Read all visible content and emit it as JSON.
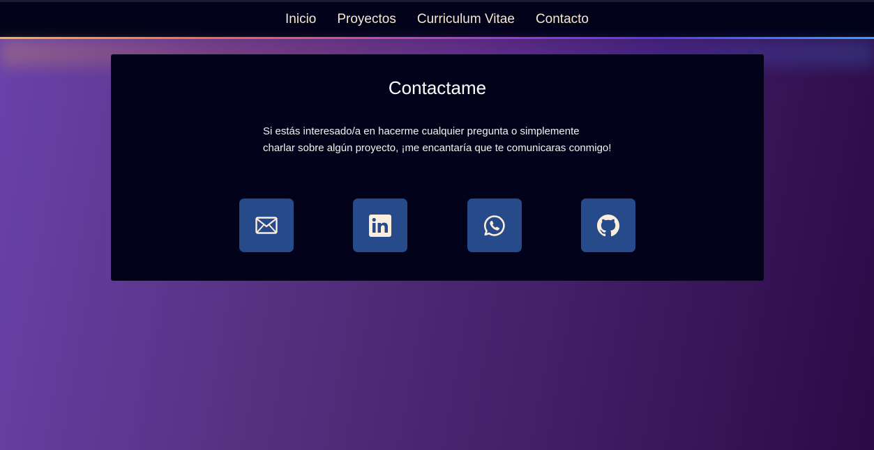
{
  "nav": {
    "items": [
      {
        "label": "Inicio"
      },
      {
        "label": "Proyectos"
      },
      {
        "label": "Curriculum Vitae"
      },
      {
        "label": "Contacto"
      }
    ]
  },
  "contact": {
    "title": "Contactame",
    "text": "Si estás interesado/a en hacerme cualquier pregunta o simplemente charlar sobre algún proyecto, ¡me encantaría que te comunicaras conmigo!",
    "links": [
      {
        "icon": "envelope-icon"
      },
      {
        "icon": "linkedin-icon"
      },
      {
        "icon": "whatsapp-icon"
      },
      {
        "icon": "github-icon"
      }
    ]
  },
  "colors": {
    "nav_text": "#f7e8cf",
    "panel_bg": "#02021a",
    "icon_button_bg": "#264a8a",
    "icon_fill": "#fbeedd"
  }
}
